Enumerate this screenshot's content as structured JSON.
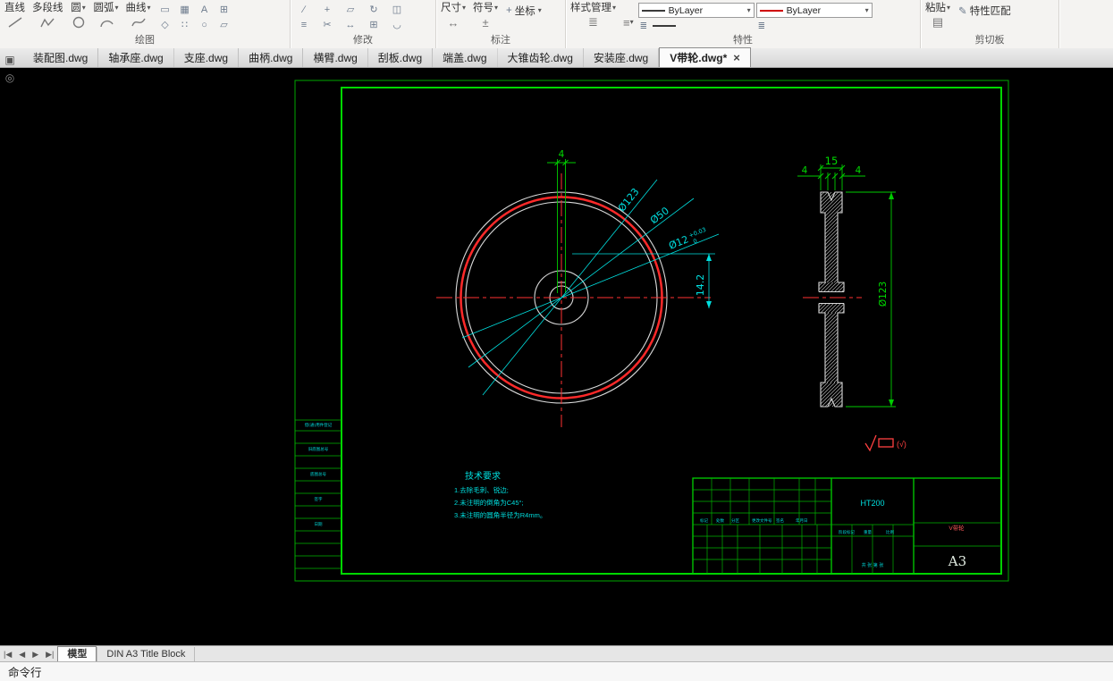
{
  "ribbon": {
    "panels": {
      "draw": {
        "label": "绘图",
        "tools": [
          "直线",
          "多段线",
          "圆",
          "圆弧",
          "曲线"
        ]
      },
      "modify": {
        "label": "修改"
      },
      "annotate": {
        "label": "标注",
        "tools": [
          "尺寸",
          "符号",
          "坐标"
        ]
      },
      "properties": {
        "label": "特性",
        "style_manager": "样式管理",
        "linetype": "ByLayer",
        "linecolor": "ByLayer"
      },
      "clipboard": {
        "label": "剪切板",
        "paste": "粘贴",
        "match_properties": "特性匹配"
      }
    }
  },
  "doc_tabs": {
    "tabs": [
      {
        "label": "装配图.dwg"
      },
      {
        "label": "轴承座.dwg"
      },
      {
        "label": "支座.dwg"
      },
      {
        "label": "曲柄.dwg"
      },
      {
        "label": "横臂.dwg"
      },
      {
        "label": "刮板.dwg"
      },
      {
        "label": "端盖.dwg"
      },
      {
        "label": "大锥齿轮.dwg"
      },
      {
        "label": "安装座.dwg"
      },
      {
        "label": "V带轮.dwg*",
        "active": true,
        "close": "×"
      }
    ]
  },
  "drawing": {
    "front": {
      "dim_width": "4",
      "dia_outer": "Ø123",
      "dia_mid": "Ø50",
      "dia_bore": "Ø12",
      "bore_tol_upper": "+0.03",
      "bore_tol_lower": "0",
      "dim_key_depth": "14.2"
    },
    "side": {
      "dim_left": "4",
      "dim_total": "15",
      "dim_right": "4",
      "dia": "Ø123"
    },
    "tech_req": {
      "title": "技术要求",
      "lines": [
        "1.去除毛刺、锐边;",
        "2.未注明的倒角为C45°;",
        "3.未注明的圆角半径为R4mm。"
      ]
    },
    "roughness": "(√)",
    "title_block": {
      "material": "HT200",
      "part_name": "V带轮",
      "sheet": "A3",
      "row_labels": [
        "标记",
        "处数",
        "分区",
        "更改文件号",
        "签名",
        "年月日"
      ],
      "info_labels": [
        "阶段标记",
        "重量",
        "比例"
      ],
      "sheet_note": "共 张 第 张",
      "side_labels": [
        "借(通)用件登记",
        "旧底图总号",
        "底图总号",
        "签字",
        "日期"
      ]
    },
    "colors": {
      "frame": "#00d800",
      "dimension": "#00e0e0",
      "centerline": "#ff3232",
      "outline": "#dadada"
    }
  },
  "bottom_tabs": {
    "tabs": [
      {
        "label": "模型",
        "active": true
      },
      {
        "label": "DIN A3 Title Block",
        "active": false
      }
    ]
  },
  "command_line": {
    "label": "命令行"
  }
}
